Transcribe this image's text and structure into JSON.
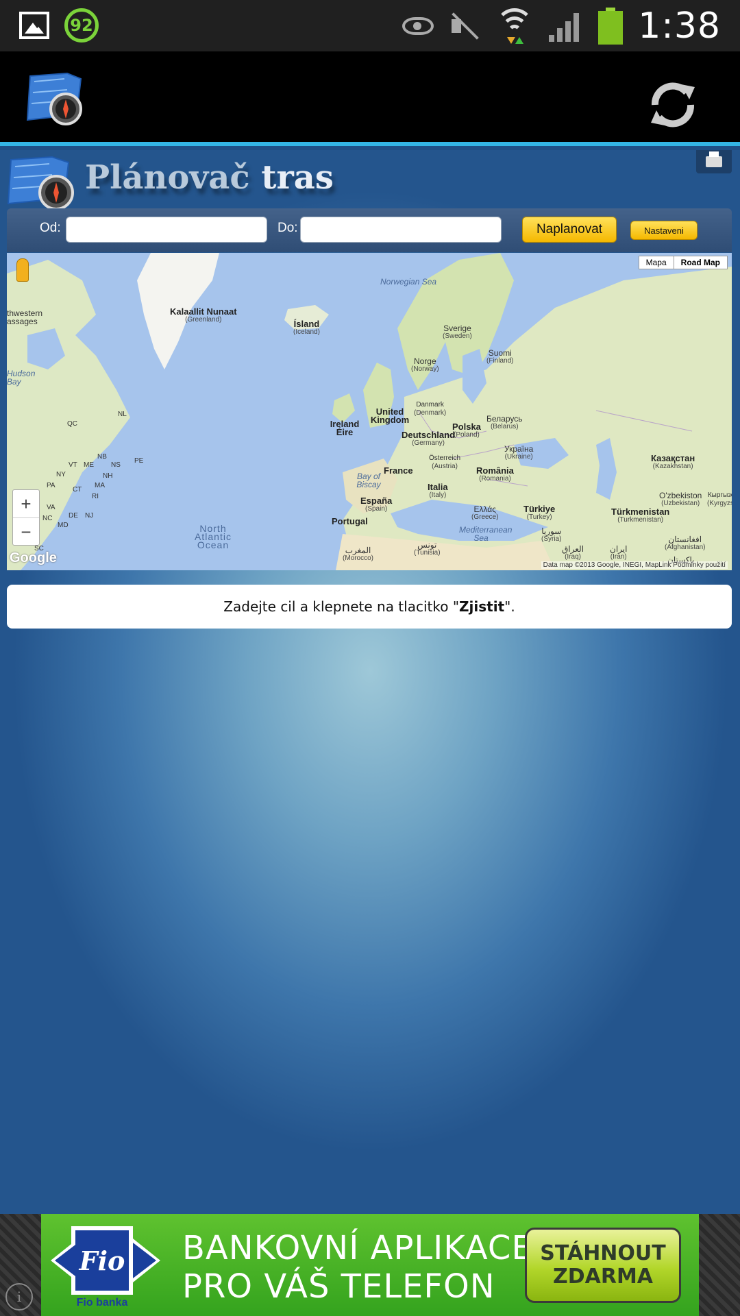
{
  "status_bar": {
    "battery_badge": "92",
    "clock": "1:38",
    "icons": [
      "gallery-icon",
      "battery-badge-icon",
      "eye-icon",
      "mute-icon",
      "wifi-icon",
      "signal-icon",
      "battery-icon"
    ]
  },
  "action_bar": {
    "icons": [
      "app-logo-icon",
      "refresh-icon"
    ],
    "accent_color": "#33b5e5"
  },
  "header": {
    "title_part1": "Plánovač",
    "title_part2": "tras"
  },
  "form": {
    "from_label": "Od:",
    "from_value": "",
    "to_label": "Do:",
    "to_value": "",
    "plan_button": "Naplanovat",
    "settings_button": "Nastaveni"
  },
  "map": {
    "type_options": [
      "Mapa",
      "Road Map"
    ],
    "zoom_in": "+",
    "zoom_out": "−",
    "google_logo": "Google",
    "attribution": "Data map ©2013 Google, INEGI, MapLink   Podmínky použití",
    "labels": {
      "norwegian_sea": "Norwegian Sea",
      "greenland": "Kalaallit Nunaat",
      "greenland_sub": "(Greenland)",
      "iceland": "Ísland",
      "iceland_sub": "(Iceland)",
      "sweden": "Sverige",
      "sweden_sub": "(Sweden)",
      "finland": "Suomi",
      "finland_sub": "(Finland)",
      "norway": "Norge",
      "norway_sub": "(Norway)",
      "denmark": "Danmark",
      "denmark_sub": "(Denmark)",
      "uk": "United Kingdom",
      "ireland": "Ireland Éire",
      "belarus": "Беларусь",
      "belarus_sub": "(Belarus)",
      "poland": "Polska",
      "poland_sub": "(Poland)",
      "germany": "Deutschland",
      "germany_sub": "(Germany)",
      "ukraine": "Україна",
      "ukraine_sub": "(Ukraine)",
      "austria": "Österreich",
      "austria_sub": "(Austria)",
      "kazakhstan": "Казақстан",
      "kazakhstan_sub": "(Kazakhstan)",
      "france": "France",
      "romania": "România",
      "romania_sub": "(Romania)",
      "biscay": "Bay of Biscay",
      "italy": "Italia",
      "italy_sub": "(Italy)",
      "uzbekistan": "O'zbekiston",
      "uzbekistan_sub": "(Uzbekistan)",
      "kyrgyzstan": "Кыргызстан",
      "kyrgyzstan_sub": "(Kyrgyzstan)",
      "spain": "España",
      "spain_sub": "(Spain)",
      "greece": "Ελλάς",
      "greece_sub": "(Greece)",
      "turkey": "Türkiye",
      "turkey_sub": "(Turkey)",
      "turkmenistan": "Türkmenistan",
      "turkmenistan_sub": "(Turkmenistan)",
      "portugal": "Portugal",
      "mediterranean": "Mediterranean Sea",
      "syria": "سوريا",
      "syria_sub": "(Syria)",
      "afghanistan": "افغانستان",
      "afghanistan_sub": "(Afghanistan)",
      "atlantic": "North Atlantic Ocean",
      "tunisia": "تونس",
      "tunisia_sub": "(Tunisia)",
      "iraq": "العراق",
      "iraq_sub": "(Iraq)",
      "iran": "ایران",
      "iran_sub": "(Iran)",
      "morocco": "المغرب",
      "morocco_sub": "(Morocco)",
      "pakistan": "پاکستان",
      "hudson": "Hudson Bay",
      "nw_passages": "thwestern assages",
      "nl": "NL",
      "qc": "QC",
      "nb": "NB",
      "vt": "VT",
      "me": "ME",
      "ns": "NS",
      "pe": "PE",
      "ny": "NY",
      "nh": "NH",
      "pa": "PA",
      "ct": "CT",
      "ma": "MA",
      "ri": "RI",
      "va": "VA",
      "nc": "NC",
      "de": "DE",
      "nj": "NJ",
      "md": "MD",
      "sc": "SC"
    }
  },
  "info": {
    "text_before": "Zadejte cil a klepnete na tlacitko \"",
    "text_bold": "Zjistit",
    "text_after": "\"."
  },
  "ad": {
    "brand": "Fio",
    "brand_sub": "Fio banka",
    "line1": "BANKOVNÍ APLIKACE",
    "line2": "PRO VÁŠ TELEFON",
    "cta_line1": "STÁHNOUT",
    "cta_line2": "ZDARMA",
    "info_glyph": "i",
    "banner_color": "#4db526"
  }
}
